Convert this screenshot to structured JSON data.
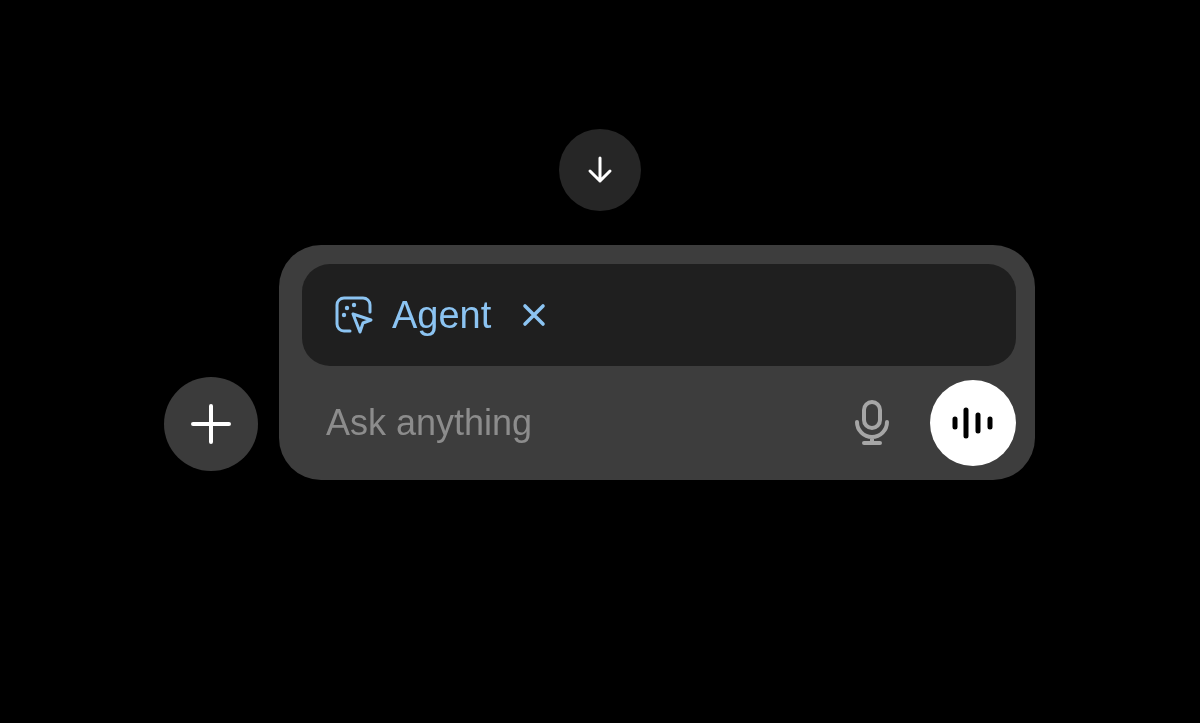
{
  "tool_chip": {
    "label": "Agent"
  },
  "prompt_field": {
    "placeholder": "Ask anything"
  }
}
